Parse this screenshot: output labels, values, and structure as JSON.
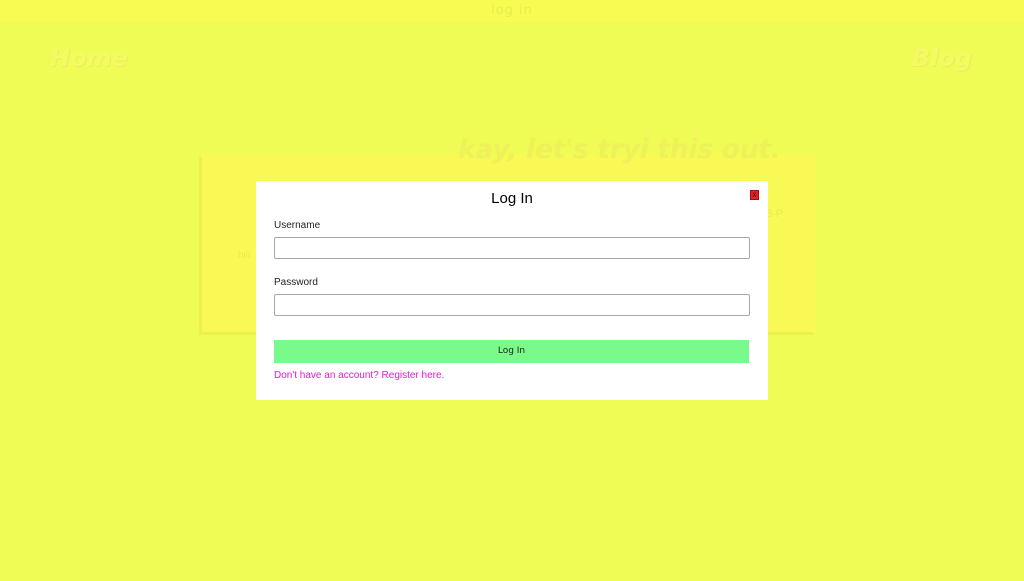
{
  "topbar": {
    "label": "log in"
  },
  "nav": {
    "home": "Home",
    "blog": "Blog"
  },
  "post": {
    "title": "kay, let's tryi this out.",
    "body": "hiii",
    "date": "8-P"
  },
  "modal": {
    "title": "Log In",
    "close_label": "x",
    "username_label": "Username",
    "username_value": "",
    "password_label": "Password",
    "password_value": "",
    "submit_label": "Log In",
    "register_link": "Don't have an account? Register here."
  },
  "colors": {
    "background": "#f0fc56",
    "submit_button": "#7afa8a",
    "link": "#e01ccf",
    "close_button": "#e82222"
  }
}
